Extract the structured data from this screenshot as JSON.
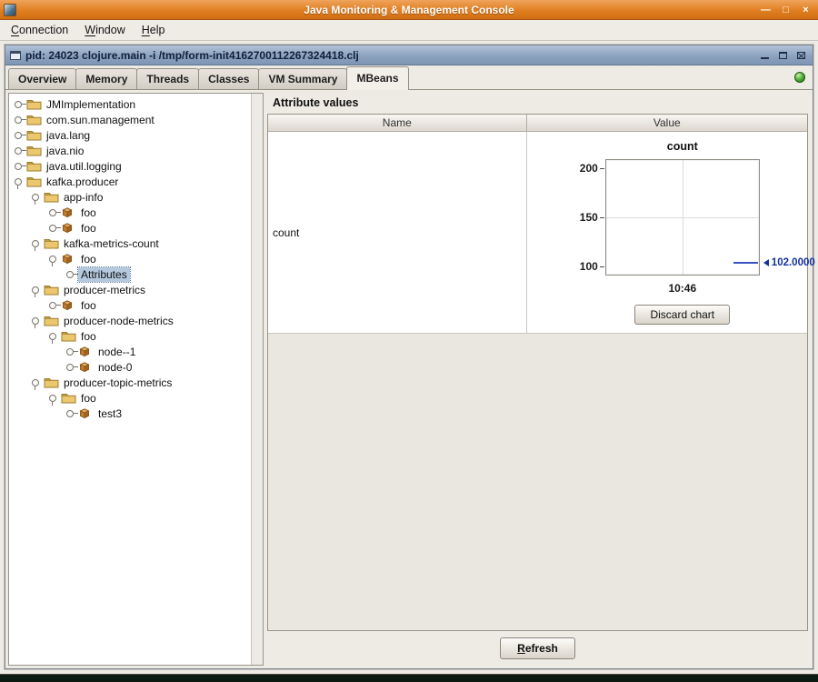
{
  "window": {
    "title": "Java Monitoring & Management Console",
    "controls": {
      "minimize": "—",
      "maximize": "□",
      "close": "×"
    },
    "menu": {
      "items": [
        {
          "label": "Connection",
          "mnemonic": "C"
        },
        {
          "label": "Window",
          "mnemonic": "W"
        },
        {
          "label": "Help",
          "mnemonic": "H"
        }
      ]
    }
  },
  "frame": {
    "title": "pid: 24023 clojure.main -i /tmp/form-init4162700112267324418.clj"
  },
  "tabs": {
    "selected": "MBeans",
    "items": [
      "Overview",
      "Memory",
      "Threads",
      "Classes",
      "VM Summary",
      "MBeans"
    ]
  },
  "tree": {
    "items": [
      {
        "label": "JMImplementation",
        "depth": 0,
        "icon": "folder",
        "state": "collapsed"
      },
      {
        "label": "com.sun.management",
        "depth": 0,
        "icon": "folder",
        "state": "collapsed"
      },
      {
        "label": "java.lang",
        "depth": 0,
        "icon": "folder",
        "state": "collapsed"
      },
      {
        "label": "java.nio",
        "depth": 0,
        "icon": "folder",
        "state": "collapsed"
      },
      {
        "label": "java.util.logging",
        "depth": 0,
        "icon": "folder",
        "state": "collapsed"
      },
      {
        "label": "kafka.producer",
        "depth": 0,
        "icon": "folder",
        "state": "expanded"
      },
      {
        "label": "app-info",
        "depth": 1,
        "icon": "folder",
        "state": "expanded"
      },
      {
        "label": "foo",
        "depth": 2,
        "icon": "bean",
        "state": "collapsed"
      },
      {
        "label": "foo",
        "depth": 2,
        "icon": "bean",
        "state": "collapsed"
      },
      {
        "label": "kafka-metrics-count",
        "depth": 1,
        "icon": "folder",
        "state": "expanded"
      },
      {
        "label": "foo",
        "depth": 2,
        "icon": "bean",
        "state": "expanded"
      },
      {
        "label": "Attributes",
        "depth": 3,
        "icon": "none",
        "state": "collapsed",
        "selected": true
      },
      {
        "label": "producer-metrics",
        "depth": 1,
        "icon": "folder",
        "state": "expanded"
      },
      {
        "label": "foo",
        "depth": 2,
        "icon": "bean",
        "state": "collapsed"
      },
      {
        "label": "producer-node-metrics",
        "depth": 1,
        "icon": "folder",
        "state": "expanded"
      },
      {
        "label": "foo",
        "depth": 2,
        "icon": "folder",
        "state": "expanded"
      },
      {
        "label": "node--1",
        "depth": 3,
        "icon": "bean",
        "state": "collapsed"
      },
      {
        "label": "node-0",
        "depth": 3,
        "icon": "bean",
        "state": "collapsed"
      },
      {
        "label": "producer-topic-metrics",
        "depth": 1,
        "icon": "folder",
        "state": "expanded"
      },
      {
        "label": "foo",
        "depth": 2,
        "icon": "folder",
        "state": "expanded"
      },
      {
        "label": "test3",
        "depth": 3,
        "icon": "bean",
        "state": "collapsed"
      }
    ]
  },
  "attributes_panel": {
    "title": "Attribute values",
    "columns": [
      "Name",
      "Value"
    ],
    "rows": [
      {
        "name": "count"
      }
    ],
    "discard_button": "Discard chart",
    "refresh_button": "Refresh"
  },
  "chart_data": {
    "type": "line",
    "title": "count",
    "yticks": [
      200,
      150,
      100
    ],
    "ylim": [
      90,
      210
    ],
    "xticks": [
      "10:46"
    ],
    "grid": true,
    "series": [
      {
        "name": "count",
        "points": [
          {
            "x": "10:46",
            "y": 102.0
          }
        ]
      }
    ],
    "current_value": 102.0,
    "current_value_label": "102.0000",
    "line_color": "#3752c2",
    "annotation_color": "#16309c"
  },
  "status": {
    "connection_indicator_color": "#47a531",
    "titlebar_color": "#e07f22",
    "selection_color": "#b4c9de"
  }
}
